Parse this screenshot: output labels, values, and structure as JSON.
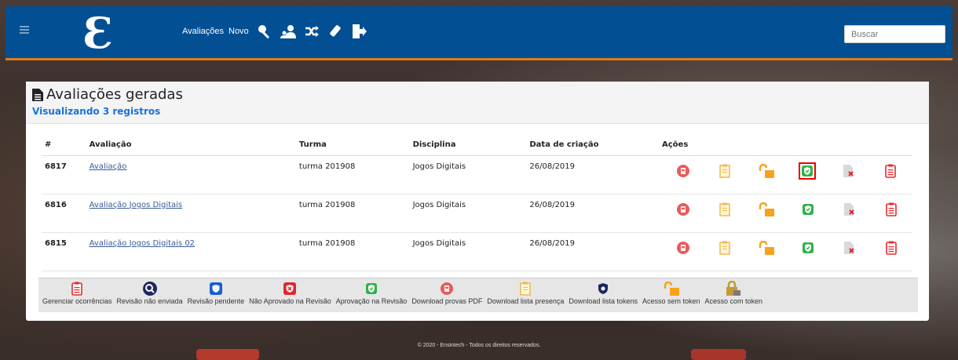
{
  "nav": {
    "links": [
      "Avaliações",
      "Novo"
    ],
    "icons": [
      "key-icon",
      "users-icon",
      "shuffle-icon",
      "eraser-icon",
      "logout-icon"
    ],
    "search_placeholder": "Buscar",
    "logo_glyph": "Ɛ",
    "colors": {
      "bar": "#034f93",
      "accent": "#e07a1b"
    }
  },
  "card": {
    "title": "Avaliações geradas",
    "subtitle": "Visualizando 3 registros"
  },
  "table": {
    "headers": [
      "#",
      "Avaliação",
      "Turma",
      "Disciplina",
      "Data de criação",
      "Ações"
    ],
    "rows": [
      {
        "id": "6817",
        "avaliacao": "Avaliação",
        "turma": "turma 201908",
        "disciplina": "Jogos Digitais",
        "data": "26/08/2019"
      },
      {
        "id": "6816",
        "avaliacao": "Avaliação Jogos Digitais",
        "turma": "turma 201908",
        "disciplina": "Jogos Digitais",
        "data": "26/08/2019"
      },
      {
        "id": "6815",
        "avaliacao": "Avaliação Jogos Digitais 02",
        "turma": "turma 201908",
        "disciplina": "Jogos Digitais",
        "data": "26/08/2019"
      }
    ],
    "actions": [
      "download-pdf-icon",
      "presence-list-icon",
      "unlocked-icon",
      "approved-icon",
      "token-list-icon",
      "occurrences-icon"
    ]
  },
  "legend": {
    "items": [
      "Gerenciar ocorrências",
      "Revisão não enviada",
      "Revisão pendente",
      "Não Aprovado na Revisão",
      "Aprovação na Revisão",
      "Download provas PDF",
      "Download lista presença",
      "Download lista tokens",
      "Acesso sem token",
      "Acesso com token"
    ]
  },
  "footer": "© 2020 - Ensintech - Todos os direitos reservados."
}
